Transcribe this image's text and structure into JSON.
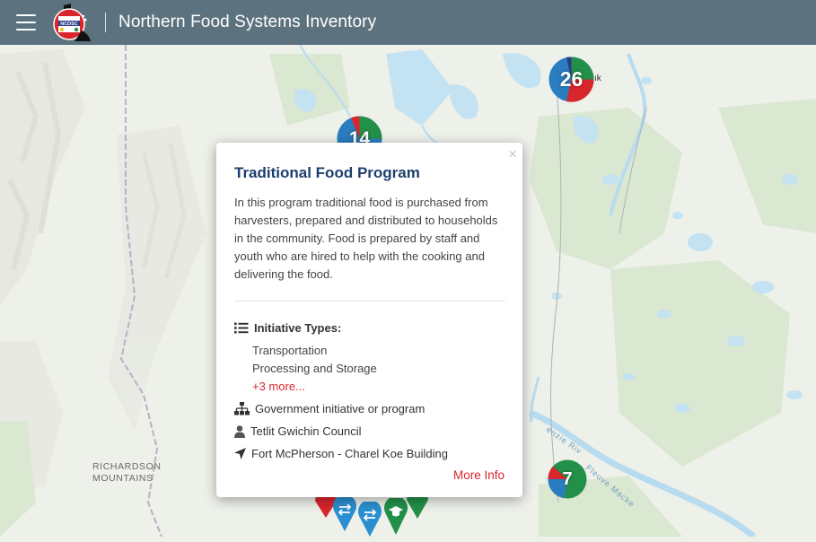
{
  "header": {
    "title": "Northern Food Systems Inventory",
    "logo_text": "NCDSC"
  },
  "map": {
    "labels": {
      "mountains": [
        "RICHARDSON",
        "MOUNTAINS"
      ],
      "place_fragment": "ık"
    },
    "clusters": [
      {
        "count": "26",
        "colors": [
          "#d9252c",
          "#2a7dc0",
          "#23904a",
          "#2c3a84"
        ]
      },
      {
        "count": "14",
        "colors": [
          "#23904a",
          "#d9252c",
          "#2a7dc0"
        ]
      },
      {
        "count": "7",
        "colors": [
          "#23904a",
          "#2a7dc0"
        ]
      }
    ],
    "markers": [
      {
        "type": "red",
        "color": "#d9252c"
      },
      {
        "type": "transport",
        "color": "#2a8fd0"
      },
      {
        "type": "transport",
        "color": "#2a8fd0"
      },
      {
        "type": "education",
        "color": "#23904a"
      },
      {
        "type": "green",
        "color": "#23904a"
      }
    ]
  },
  "popup": {
    "close": "×",
    "title": "Traditional Food Program",
    "description": "In this program traditional food is purchased from harvesters, prepared and distributed to households in the community. Food is prepared by staff and youth who are hired to help with the cooking and delivering the food.",
    "initiative_types_label": "Initiative Types:",
    "initiative_types": [
      "Transportation",
      "Processing and Storage"
    ],
    "more_types": "+3 more...",
    "organization_type": "Government initiative or program",
    "organization": "Tetlit Gwichin Council",
    "location": "Fort McPherson - Charel Koe Building",
    "more_info": "More Info"
  },
  "colors": {
    "header_bg": "#48606e",
    "accent_red": "#d9252c",
    "title_blue": "#1c3f6e",
    "water": "#c3e2f2",
    "land": "#eef1ea",
    "forest": "#dbe8d2"
  }
}
